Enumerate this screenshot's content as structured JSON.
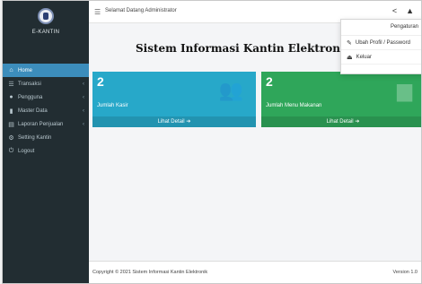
{
  "brand": {
    "name": "E-KANTIN"
  },
  "sidebar": {
    "items": [
      {
        "label": "Home",
        "icon": "home-icon",
        "active": true
      },
      {
        "label": "Transaksi",
        "icon": "list-icon",
        "has_children": true
      },
      {
        "label": "Pengguna",
        "icon": "user-icon",
        "has_children": true
      },
      {
        "label": "Master Data",
        "icon": "book-icon",
        "has_children": true
      },
      {
        "label": "Laporan Penjualan",
        "icon": "report-icon",
        "has_children": true
      },
      {
        "label": "Setting Kantin",
        "icon": "gear-icon"
      },
      {
        "label": "Logout",
        "icon": "logout-icon"
      }
    ]
  },
  "topbar": {
    "title": "Selamat Datang Administrator"
  },
  "content": {
    "page_title": "Sistem Informasi Kantin Elektronik (E-Kantin)",
    "boxes": [
      {
        "value": "2",
        "label": "Jumlah Kasir",
        "footer": "Lihat Detail",
        "color": "#27a8c9",
        "icon": "users-icon"
      },
      {
        "value": "2",
        "label": "Jumlah Menu Makanan",
        "footer": "Lihat Detail",
        "color": "#2fa65a",
        "icon": "document-icon"
      }
    ]
  },
  "dropdown": {
    "header": "Pengaturan",
    "items": [
      {
        "label": "Ubah Profil / Password",
        "icon": "edit-icon"
      },
      {
        "label": "Keluar",
        "icon": "signout-icon"
      }
    ]
  },
  "footer": {
    "left": "Copyright © 2021 Sistem Informasi Kantin Elektronik",
    "right": "Version 1.0"
  }
}
